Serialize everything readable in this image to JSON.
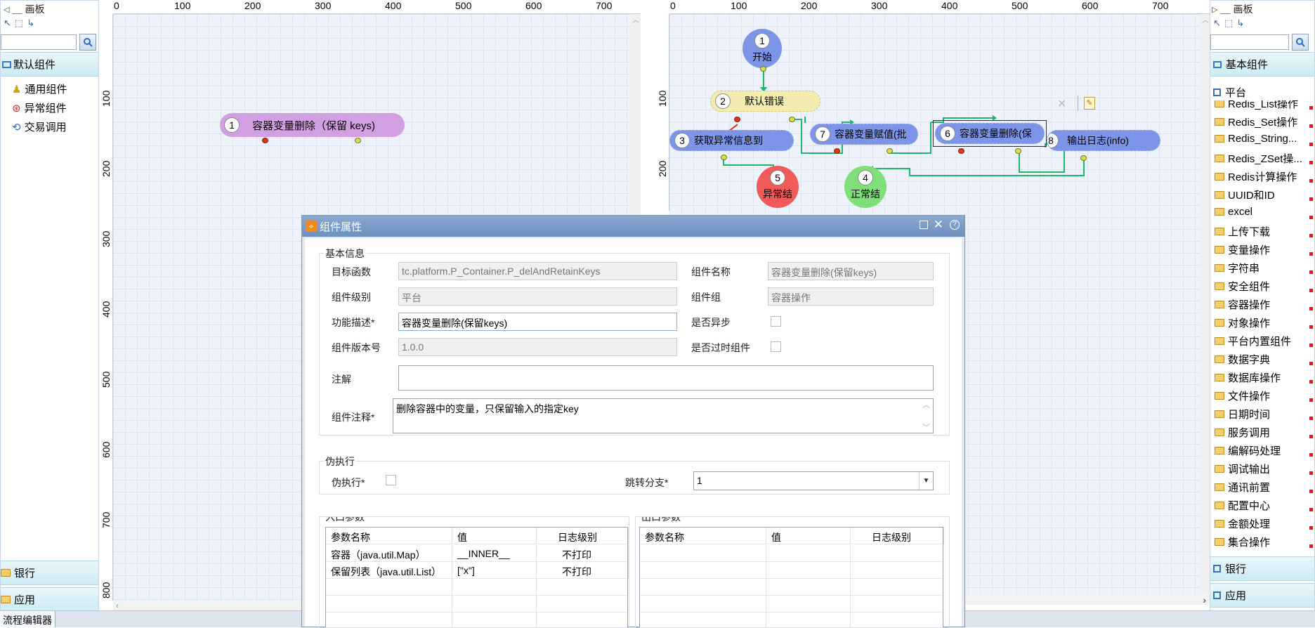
{
  "left_palette": {
    "title": "画板",
    "categories": [
      {
        "label": "默认组件"
      }
    ],
    "items": [
      {
        "label": "通用组件"
      },
      {
        "label": "异常组件"
      },
      {
        "label": "交易调用"
      }
    ],
    "bottom_sections": [
      {
        "label": "银行"
      },
      {
        "label": "应用"
      }
    ]
  },
  "right_palette": {
    "title": "画板",
    "top_sections": [
      {
        "label": "基本组件"
      },
      {
        "label": "平台"
      }
    ],
    "items": [
      {
        "label": "Redis_List操作"
      },
      {
        "label": "Redis_Set操作"
      },
      {
        "label": "Redis_String..."
      },
      {
        "label": "Redis_ZSet操..."
      },
      {
        "label": "Redis计算操作"
      },
      {
        "label": "UUID和ID"
      },
      {
        "label": "excel"
      },
      {
        "label": "上传下载"
      },
      {
        "label": "变量操作"
      },
      {
        "label": "字符串"
      },
      {
        "label": "安全组件"
      },
      {
        "label": "容器操作"
      },
      {
        "label": "对象操作"
      },
      {
        "label": "平台内置组件"
      },
      {
        "label": "数据字典"
      },
      {
        "label": "数据库操作"
      },
      {
        "label": "文件操作"
      },
      {
        "label": "日期时间"
      },
      {
        "label": "服务调用"
      },
      {
        "label": "编解码处理"
      },
      {
        "label": "调试输出"
      },
      {
        "label": "通讯前置"
      },
      {
        "label": "配置中心"
      },
      {
        "label": "金额处理"
      },
      {
        "label": "集合操作"
      }
    ],
    "bottom_sections": [
      {
        "label": "银行"
      },
      {
        "label": "应用"
      }
    ]
  },
  "ruler": {
    "x_ticks": [
      "0",
      "100",
      "200",
      "300",
      "400",
      "500",
      "600",
      "700"
    ],
    "y_ticks": [
      "100",
      "200",
      "300",
      "400",
      "500",
      "600",
      "700",
      "800"
    ]
  },
  "left_canvas": {
    "node": {
      "number": "1",
      "label": "容器变量删除（保留 keys)"
    }
  },
  "right_canvas": {
    "nodes": [
      {
        "number": "1",
        "label": "开始"
      },
      {
        "number": "2",
        "label": "默认错误"
      },
      {
        "number": "3",
        "label": "获取异常信息到"
      },
      {
        "number": "7",
        "label": "容器变量赋值(批"
      },
      {
        "number": "6",
        "label": "容器变量删除(保"
      },
      {
        "number": "8",
        "label": "输出日志(info)"
      },
      {
        "number": "5",
        "label": "异常结"
      },
      {
        "number": "4",
        "label": "正常结"
      }
    ]
  },
  "dialog": {
    "title": "组件属性",
    "basic_info": {
      "group_title": "基本信息",
      "target_function_label": "目标函数",
      "target_function_value": "tc.platform.P_Container.P_delAndRetainKeys",
      "component_name_label": "组件名称",
      "component_name_value": "容器变量删除(保留keys)",
      "component_level_label": "组件级别",
      "component_level_value": "平台",
      "component_group_label": "组件组",
      "component_group_value": "容器操作",
      "description_label": "功能描述*",
      "description_value": "容器变量删除(保留keys)",
      "async_label": "是否异步",
      "version_label": "组件版本号",
      "version_value": "1.0.0",
      "deprecated_label": "是否过时组件",
      "annotation_label": "注解",
      "annotation_value": "",
      "comment_label": "组件注释*",
      "comment_value": "删除容器中的变量，只保留输入的指定key"
    },
    "pseudo": {
      "group_title": "伪执行",
      "pseudo_label": "伪执行*",
      "branch_label": "跳转分支*",
      "branch_value": "1"
    },
    "input_params": {
      "group_title": "入口参数",
      "columns": [
        "参数名称",
        "值",
        "日志级别"
      ],
      "rows": [
        [
          "容器（java.util.Map）",
          "__INNER__",
          "不打印"
        ],
        [
          "保留列表（java.util.List）",
          "[\"x\"]",
          "不打印"
        ]
      ]
    },
    "output_params": {
      "group_title": "出口参数",
      "columns": [
        "参数名称",
        "值",
        "日志级别"
      ]
    }
  },
  "statusbar": {
    "tab": "流程编辑器"
  },
  "colors": {
    "canvas_bg": "#eef2fb",
    "node_blue": "#7d95e8",
    "node_yellow": "#f3ecb0",
    "node_purple": "#d29fe3",
    "node_red": "#f25a5a",
    "node_green": "#7fe07a",
    "connector": "#1fb56a",
    "dialog_header": "#7a9ac6"
  }
}
